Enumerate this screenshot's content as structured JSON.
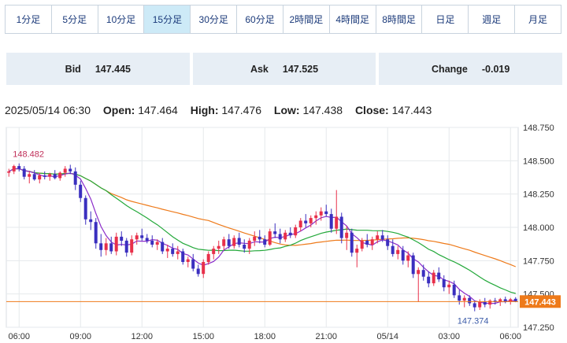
{
  "timeframe_tabs": [
    {
      "label": "1分足",
      "active": false
    },
    {
      "label": "5分足",
      "active": false
    },
    {
      "label": "10分足",
      "active": false
    },
    {
      "label": "15分足",
      "active": true
    },
    {
      "label": "30分足",
      "active": false
    },
    {
      "label": "60分足",
      "active": false
    },
    {
      "label": "2時間足",
      "active": false
    },
    {
      "label": "4時間足",
      "active": false
    },
    {
      "label": "8時間足",
      "active": false
    },
    {
      "label": "日足",
      "active": false
    },
    {
      "label": "週足",
      "active": false
    },
    {
      "label": "月足",
      "active": false
    }
  ],
  "quote": {
    "bid_label": "Bid",
    "bid_value": "147.445",
    "ask_label": "Ask",
    "ask_value": "147.525",
    "change_label": "Change",
    "change_value": "-0.019"
  },
  "ohlc": {
    "datetime": "2025/05/14 06:30",
    "open_label": "Open:",
    "open": "147.464",
    "high_label": "High:",
    "high": "147.476",
    "low_label": "Low:",
    "low": "147.438",
    "close_label": "Close:",
    "close": "147.443"
  },
  "chart_data": {
    "type": "candlestick",
    "y_ticks": [
      148.75,
      148.5,
      148.25,
      148.0,
      147.75,
      147.5,
      147.25
    ],
    "y_tick_labels": [
      "148.750",
      "148.500",
      "148.250",
      "148.000",
      "147.750",
      "147.500",
      "147.250"
    ],
    "ylim": [
      147.25,
      148.75
    ],
    "x_tick_labels": [
      "06:00",
      "09:00",
      "12:00",
      "15:00",
      "18:00",
      "21:00",
      "05/14",
      "03:00",
      "06:00"
    ],
    "x_tick_candle_index": [
      2,
      14,
      26,
      38,
      50,
      62,
      74,
      86,
      98
    ],
    "annotations": {
      "high_label": "148.482",
      "low_label": "147.374",
      "last_price_label": "147.443"
    },
    "last_price": 147.443,
    "colors": {
      "up": "#e8304a",
      "down": "#3a2fbf",
      "ma_short": "#8b2cc9",
      "ma_mid": "#23a83a",
      "ma_long": "#ee7a1a",
      "last_line": "#ee7a1a",
      "last_tag": "#ee7a1a"
    },
    "ma_periods": [
      5,
      20,
      40
    ],
    "candles": [
      [
        148.41,
        148.44,
        148.38,
        148.42
      ],
      [
        148.42,
        148.47,
        148.4,
        148.46
      ],
      [
        148.46,
        148.48,
        148.42,
        148.44
      ],
      [
        148.44,
        148.46,
        148.36,
        148.38
      ],
      [
        148.38,
        148.42,
        148.33,
        148.4
      ],
      [
        148.4,
        148.43,
        148.35,
        148.36
      ],
      [
        148.36,
        148.41,
        148.33,
        148.39
      ],
      [
        148.39,
        148.42,
        148.36,
        148.38
      ],
      [
        148.38,
        148.41,
        148.35,
        148.4
      ],
      [
        148.4,
        148.43,
        148.36,
        148.37
      ],
      [
        148.37,
        148.42,
        148.35,
        148.41
      ],
      [
        148.41,
        148.46,
        148.38,
        148.44
      ],
      [
        148.44,
        148.47,
        148.4,
        148.42
      ],
      [
        148.42,
        148.45,
        148.28,
        148.32
      ],
      [
        148.32,
        148.35,
        148.19,
        148.22
      ],
      [
        148.22,
        148.24,
        148.02,
        148.06
      ],
      [
        148.06,
        148.12,
        147.98,
        148.04
      ],
      [
        148.04,
        148.07,
        147.84,
        147.88
      ],
      [
        147.88,
        147.95,
        147.78,
        147.83
      ],
      [
        147.83,
        147.92,
        147.79,
        147.88
      ],
      [
        147.88,
        147.93,
        147.8,
        147.82
      ],
      [
        147.82,
        147.96,
        147.79,
        147.93
      ],
      [
        147.93,
        147.97,
        147.86,
        147.9
      ],
      [
        147.9,
        147.92,
        147.78,
        147.81
      ],
      [
        147.81,
        147.94,
        147.79,
        147.91
      ],
      [
        147.91,
        147.96,
        147.87,
        147.94
      ],
      [
        147.94,
        147.99,
        147.9,
        147.92
      ],
      [
        147.92,
        147.95,
        147.88,
        147.9
      ],
      [
        147.9,
        147.94,
        147.85,
        147.87
      ],
      [
        147.87,
        147.91,
        147.83,
        147.89
      ],
      [
        147.89,
        147.92,
        147.8,
        147.82
      ],
      [
        147.82,
        147.87,
        147.77,
        147.84
      ],
      [
        147.84,
        147.88,
        147.78,
        147.8
      ],
      [
        147.8,
        147.86,
        147.76,
        147.82
      ],
      [
        147.82,
        147.84,
        147.72,
        147.74
      ],
      [
        147.74,
        147.78,
        147.7,
        147.76
      ],
      [
        147.76,
        147.8,
        147.67,
        147.69
      ],
      [
        147.69,
        147.72,
        147.63,
        147.65
      ],
      [
        147.65,
        147.76,
        147.62,
        147.74
      ],
      [
        147.74,
        147.82,
        147.72,
        147.8
      ],
      [
        147.8,
        147.86,
        147.76,
        147.84
      ],
      [
        147.84,
        147.9,
        147.8,
        147.86
      ],
      [
        147.86,
        147.93,
        147.83,
        147.91
      ],
      [
        147.91,
        147.95,
        147.84,
        147.86
      ],
      [
        147.86,
        147.94,
        147.84,
        147.92
      ],
      [
        147.92,
        147.96,
        147.85,
        147.87
      ],
      [
        147.87,
        147.91,
        147.81,
        147.84
      ],
      [
        147.84,
        147.92,
        147.8,
        147.9
      ],
      [
        147.9,
        147.97,
        147.86,
        147.93
      ],
      [
        147.93,
        147.98,
        147.88,
        147.91
      ],
      [
        147.91,
        147.94,
        147.85,
        147.87
      ],
      [
        147.87,
        147.99,
        147.86,
        147.97
      ],
      [
        147.97,
        148.03,
        147.92,
        147.95
      ],
      [
        147.95,
        147.99,
        147.88,
        147.91
      ],
      [
        147.91,
        147.98,
        147.89,
        147.96
      ],
      [
        147.96,
        148.0,
        147.92,
        147.94
      ],
      [
        147.94,
        148.02,
        147.92,
        148.0
      ],
      [
        148.0,
        148.07,
        147.97,
        148.05
      ],
      [
        148.05,
        148.1,
        148.0,
        148.03
      ],
      [
        148.03,
        148.09,
        148.0,
        148.07
      ],
      [
        148.07,
        148.12,
        148.02,
        148.09
      ],
      [
        148.09,
        148.15,
        148.05,
        148.12
      ],
      [
        148.12,
        148.17,
        148.08,
        148.1
      ],
      [
        148.1,
        148.14,
        147.96,
        147.99
      ],
      [
        147.99,
        148.28,
        147.95,
        148.08
      ],
      [
        148.08,
        148.11,
        147.88,
        147.92
      ],
      [
        147.92,
        148.01,
        147.83,
        147.96
      ],
      [
        147.96,
        147.99,
        147.78,
        147.81
      ],
      [
        147.81,
        147.87,
        147.7,
        147.84
      ],
      [
        147.84,
        147.92,
        147.82,
        147.9
      ],
      [
        147.9,
        147.95,
        147.85,
        147.87
      ],
      [
        147.87,
        147.93,
        147.83,
        147.91
      ],
      [
        147.91,
        147.97,
        147.88,
        147.94
      ],
      [
        147.94,
        147.98,
        147.89,
        147.91
      ],
      [
        147.91,
        147.94,
        147.83,
        147.86
      ],
      [
        147.86,
        147.91,
        147.78,
        147.8
      ],
      [
        147.8,
        147.86,
        147.76,
        147.83
      ],
      [
        147.83,
        147.86,
        147.72,
        147.75
      ],
      [
        147.75,
        147.82,
        147.7,
        147.79
      ],
      [
        147.79,
        147.81,
        147.62,
        147.65
      ],
      [
        147.65,
        147.7,
        147.44,
        147.68
      ],
      [
        147.68,
        147.72,
        147.6,
        147.63
      ],
      [
        147.63,
        147.67,
        147.55,
        147.58
      ],
      [
        147.58,
        147.68,
        147.56,
        147.66
      ],
      [
        147.66,
        147.7,
        147.59,
        147.61
      ],
      [
        147.61,
        147.64,
        147.52,
        147.55
      ],
      [
        147.55,
        147.6,
        147.5,
        147.57
      ],
      [
        147.57,
        147.6,
        147.47,
        147.49
      ],
      [
        147.49,
        147.53,
        147.42,
        147.45
      ],
      [
        147.45,
        147.49,
        147.4,
        147.47
      ],
      [
        147.47,
        147.49,
        147.41,
        147.43
      ],
      [
        147.43,
        147.45,
        147.37,
        147.4
      ],
      [
        147.4,
        147.46,
        147.38,
        147.44
      ],
      [
        147.44,
        147.47,
        147.4,
        147.42
      ],
      [
        147.42,
        147.46,
        147.39,
        147.45
      ],
      [
        147.45,
        147.47,
        147.42,
        147.44
      ],
      [
        147.44,
        147.47,
        147.41,
        147.46
      ],
      [
        147.46,
        147.48,
        147.43,
        147.44
      ],
      [
        147.44,
        147.47,
        147.42,
        147.46
      ],
      [
        147.464,
        147.476,
        147.438,
        147.443
      ]
    ]
  }
}
